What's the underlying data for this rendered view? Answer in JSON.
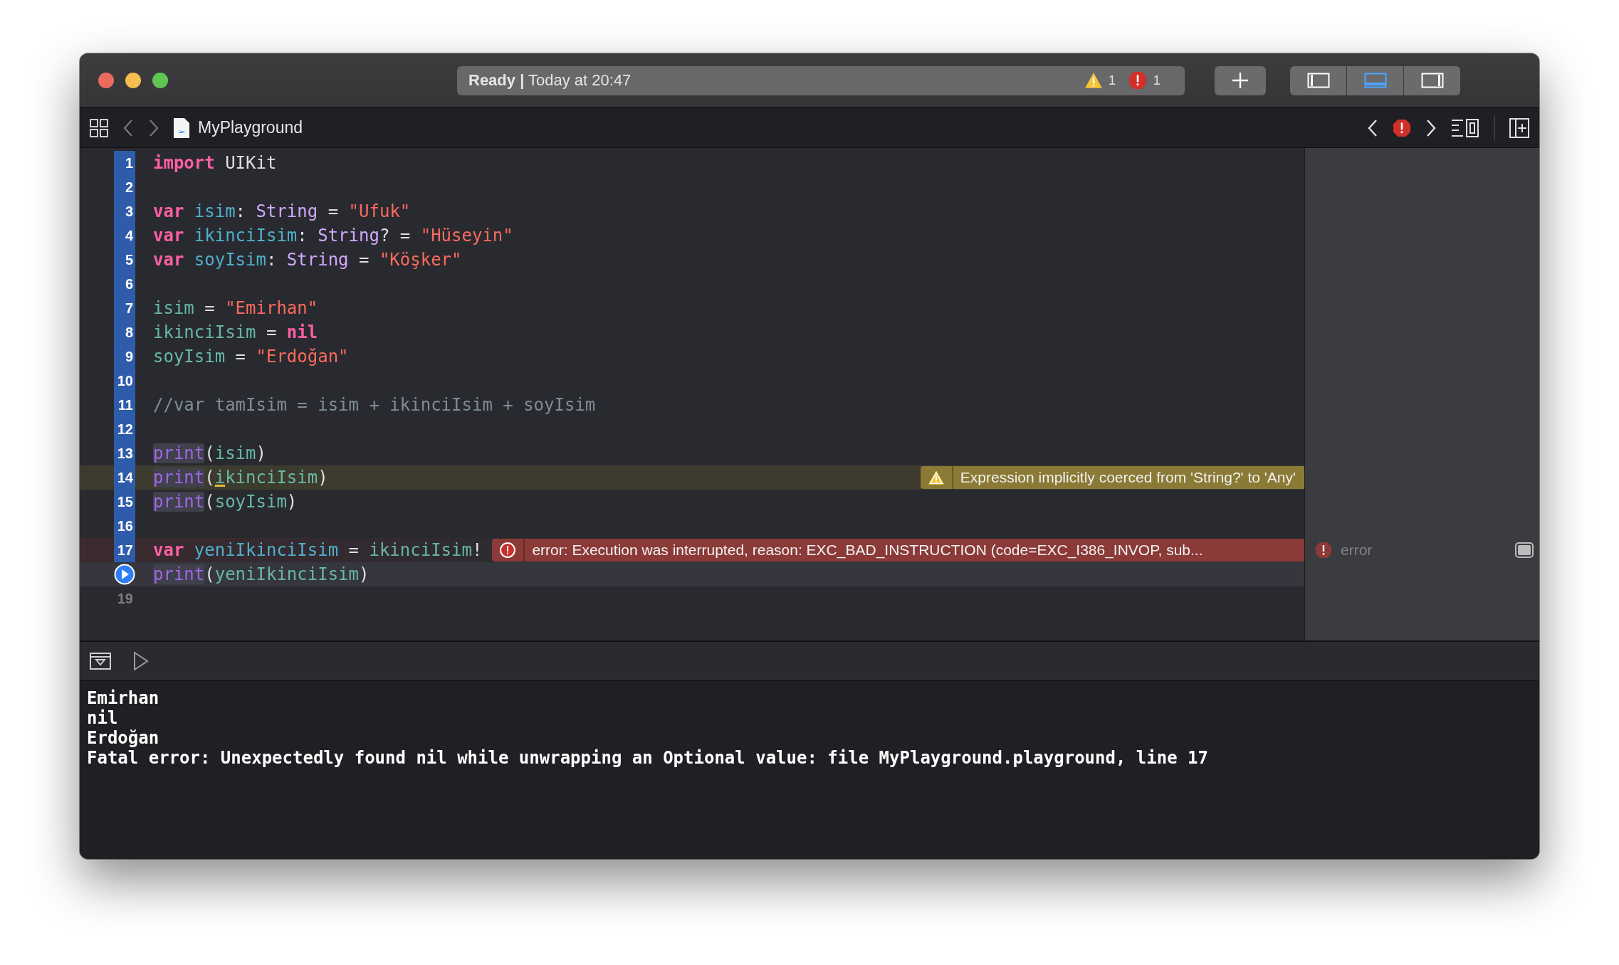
{
  "activity": {
    "status": "**Ready |** Today at 20:47",
    "warnings": "1",
    "errors": "1"
  },
  "panel_toggles": [
    {
      "kind": "left",
      "selected": false
    },
    {
      "kind": "bottom",
      "selected": true
    },
    {
      "kind": "right",
      "selected": false
    }
  ],
  "jump_bar": {
    "file": "MyPlayground"
  },
  "editor": {
    "lines": [
      {
        "number": "1",
        "executed": true,
        "tokens": [
          {
            "kind": "keyword",
            "text": "import"
          },
          {
            "kind": "plain",
            "text": " UIKit"
          }
        ]
      },
      {
        "number": "2",
        "executed": true
      },
      {
        "number": "3",
        "executed": true,
        "tokens": [
          {
            "kind": "keyword",
            "text": "var"
          },
          {
            "kind": "decl",
            "text": " isim"
          },
          {
            "kind": "plain",
            "text": ": "
          },
          {
            "kind": "type",
            "text": "String"
          },
          {
            "kind": "plain",
            "text": " = "
          },
          {
            "kind": "string",
            "text": "\"Ufuk\""
          }
        ]
      },
      {
        "number": "4",
        "executed": true,
        "tokens": [
          {
            "kind": "keyword",
            "text": "var"
          },
          {
            "kind": "decl",
            "text": " ikinciIsim"
          },
          {
            "kind": "plain",
            "text": ": "
          },
          {
            "kind": "type",
            "text": "String"
          },
          {
            "kind": "plain",
            "text": "? = "
          },
          {
            "kind": "string",
            "text": "\"Hüseyin\""
          }
        ]
      },
      {
        "number": "5",
        "executed": true,
        "tokens": [
          {
            "kind": "keyword",
            "text": "var"
          },
          {
            "kind": "decl",
            "text": " soyIsim"
          },
          {
            "kind": "plain",
            "text": ": "
          },
          {
            "kind": "type",
            "text": "String"
          },
          {
            "kind": "plain",
            "text": " = "
          },
          {
            "kind": "string",
            "text": "\"Köşker\""
          }
        ]
      },
      {
        "number": "6",
        "executed": true
      },
      {
        "number": "7",
        "executed": true,
        "tokens": [
          {
            "kind": "ident",
            "text": "isim"
          },
          {
            "kind": "plain",
            "text": " = "
          },
          {
            "kind": "string",
            "text": "\"Emirhan\""
          }
        ]
      },
      {
        "number": "8",
        "executed": true,
        "tokens": [
          {
            "kind": "ident",
            "text": "ikinciIsim"
          },
          {
            "kind": "plain",
            "text": " = "
          },
          {
            "kind": "keyword",
            "text": "nil"
          }
        ]
      },
      {
        "number": "9",
        "executed": true,
        "tokens": [
          {
            "kind": "ident",
            "text": "soyIsim"
          },
          {
            "kind": "plain",
            "text": " = "
          },
          {
            "kind": "string",
            "text": "\"Erdoğan\""
          }
        ]
      },
      {
        "number": "10",
        "executed": true
      },
      {
        "number": "11",
        "executed": true,
        "tokens": [
          {
            "kind": "comment",
            "text": "//var tamIsim = isim + ikinciIsim + soyIsim"
          }
        ]
      },
      {
        "number": "12",
        "executed": true
      },
      {
        "number": "13",
        "executed": true,
        "tokens": [
          {
            "kind": "call",
            "text": "print"
          },
          {
            "kind": "plain",
            "text": "("
          },
          {
            "kind": "ident",
            "text": "isim"
          },
          {
            "kind": "plain",
            "text": ")"
          }
        ]
      },
      {
        "number": "14",
        "executed": true,
        "warning": true,
        "tokens": [
          {
            "kind": "call",
            "text": "print"
          },
          {
            "kind": "plain",
            "text": "("
          },
          {
            "kind": "ident-warned",
            "text": "i"
          },
          {
            "kind": "ident",
            "text": "kinciIsim"
          },
          {
            "kind": "plain",
            "text": ")"
          }
        ],
        "annotation": {
          "kind": "warning",
          "text": "Expression implicitly coerced from 'String?' to 'Any'"
        }
      },
      {
        "number": "15",
        "executed": true,
        "tokens": [
          {
            "kind": "call",
            "text": "print"
          },
          {
            "kind": "plain",
            "text": "("
          },
          {
            "kind": "ident",
            "text": "soyIsim"
          },
          {
            "kind": "plain",
            "text": ")"
          }
        ]
      },
      {
        "number": "16",
        "executed": true
      },
      {
        "number": "17",
        "executed": true,
        "error": true,
        "tokens": [
          {
            "kind": "keyword",
            "text": "var"
          },
          {
            "kind": "decl",
            "text": " yeniIkinciIsim"
          },
          {
            "kind": "plain",
            "text": " = "
          },
          {
            "kind": "ident",
            "text": "ikinciIsim"
          },
          {
            "kind": "plain",
            "text": "!"
          }
        ],
        "annotation": {
          "kind": "error",
          "text": "error: Execution was interrupted, reason: EXC_BAD_INSTRUCTION (code=EXC_I386_INVOP, sub..."
        },
        "result": "error"
      },
      {
        "run_button": true,
        "current": true,
        "tokens": [
          {
            "kind": "call",
            "text": "print"
          },
          {
            "kind": "plain",
            "text": "("
          },
          {
            "kind": "ident",
            "text": "yeniIkinciIsim"
          },
          {
            "kind": "plain",
            "text": ")"
          }
        ]
      },
      {
        "number": "19",
        "executed": false
      }
    ]
  },
  "console": {
    "lines": [
      "Emirhan",
      "nil",
      "Erdoğan",
      "Fatal error: Unexpectedly found nil while unwrapping an Optional value: file MyPlayground.playground, line 17"
    ]
  }
}
